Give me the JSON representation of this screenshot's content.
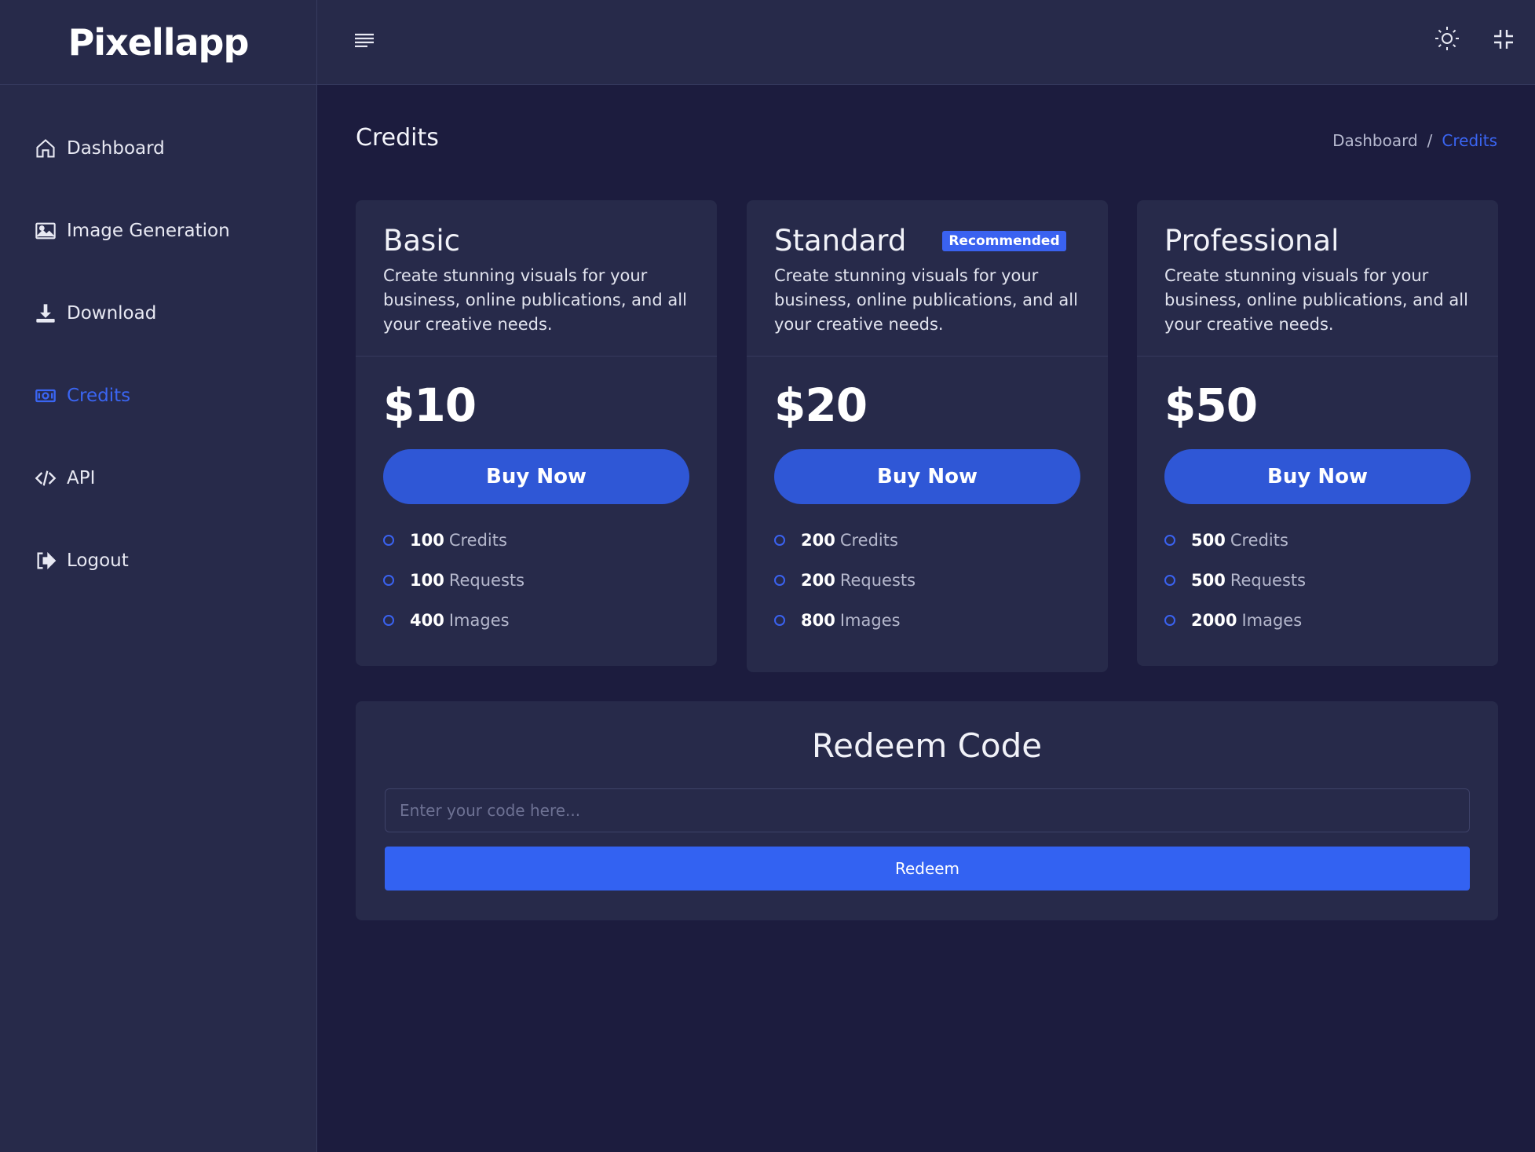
{
  "app": {
    "logo": "Pixellapp"
  },
  "sidebar": {
    "items": [
      {
        "label": "Dashboard",
        "icon": "home-icon"
      },
      {
        "label": "Image Generation",
        "icon": "image-icon"
      },
      {
        "label": "Download",
        "icon": "download-icon"
      },
      {
        "label": "Credits",
        "icon": "credits-icon",
        "active": true
      },
      {
        "label": "API",
        "icon": "code-icon"
      },
      {
        "label": "Logout",
        "icon": "logout-icon"
      }
    ]
  },
  "header": {
    "title": "Credits",
    "breadcrumb": {
      "root": "Dashboard",
      "separator": "/",
      "current": "Credits"
    }
  },
  "plans": [
    {
      "name": "Basic",
      "description": "Create stunning visuals for your business, online publications, and all your creative needs.",
      "price": "$10",
      "button": "Buy Now",
      "features": [
        {
          "value": "100",
          "label": "Credits"
        },
        {
          "value": "100",
          "label": "Requests"
        },
        {
          "value": "400",
          "label": "Images"
        }
      ]
    },
    {
      "name": "Standard",
      "badge": "Recommended",
      "description": "Create stunning visuals for your business, online publications, and all your creative needs.",
      "price": "$20",
      "button": "Buy Now",
      "features": [
        {
          "value": "200",
          "label": "Credits"
        },
        {
          "value": "200",
          "label": "Requests"
        },
        {
          "value": "800",
          "label": "Images"
        }
      ]
    },
    {
      "name": "Professional",
      "description": "Create stunning visuals for your business, online publications, and all your creative needs.",
      "price": "$50",
      "button": "Buy Now",
      "features": [
        {
          "value": "500",
          "label": "Credits"
        },
        {
          "value": "500",
          "label": "Requests"
        },
        {
          "value": "2000",
          "label": "Images"
        }
      ]
    }
  ],
  "redeem": {
    "title": "Redeem Code",
    "placeholder": "Enter your code here...",
    "button": "Redeem"
  },
  "colors": {
    "accent": "#3362f2",
    "sidebar_bg": "#272a4a",
    "page_bg": "#1c1c3e"
  }
}
